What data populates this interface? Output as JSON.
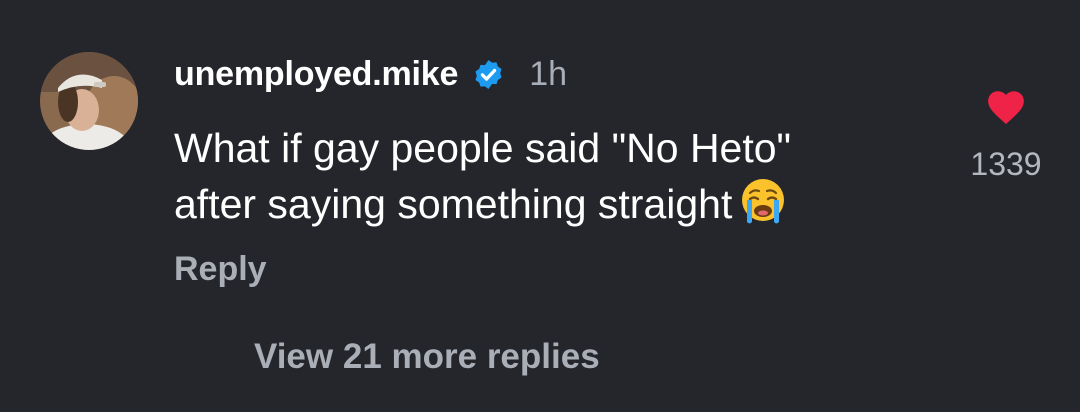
{
  "comment": {
    "author": {
      "username": "unemployed.mike",
      "verified_icon": "verified-badge-icon",
      "avatar_icon": "profile-photo"
    },
    "timestamp": "1h",
    "text_lines": [
      "What if gay people said \"No Heto\"",
      "after saying something straight"
    ],
    "emoji_icon": "loudly-crying-face-emoji",
    "reply_label": "Reply",
    "likes": {
      "icon": "heart-icon",
      "count": "1339",
      "liked": true
    }
  },
  "replies": {
    "view_more_label": "View 21 more replies"
  },
  "colors": {
    "background": "#25262b",
    "primary_text": "#ffffff",
    "secondary_text": "#a9aeb7",
    "verified_blue": "#1d9bf0",
    "like_red": "#ef2347"
  }
}
